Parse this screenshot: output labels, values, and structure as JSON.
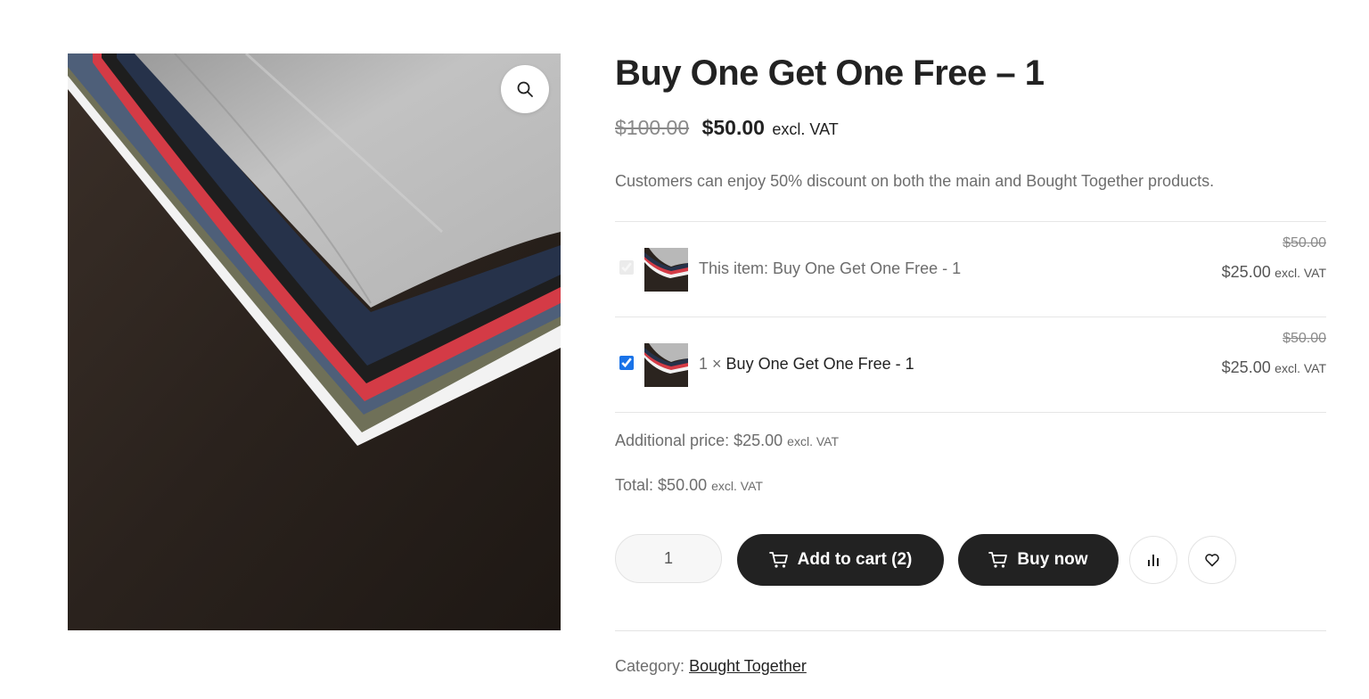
{
  "gallery": {
    "image_alt": "stack of folded t-shirts",
    "zoom_icon": "magnifier-icon"
  },
  "product": {
    "title": "Buy One Get One Free – 1",
    "price_old": "$100.00",
    "price_new": "$50.00",
    "price_suffix": "excl. VAT",
    "short_description": "Customers can enjoy 50% discount on both the main and Bought Together products."
  },
  "bought_together": {
    "items": [
      {
        "checked": true,
        "disabled": true,
        "qty_prefix": "",
        "name": "This item: Buy One Get One Free - 1",
        "price_old": "$50.00",
        "price_new": "$25.00",
        "price_suffix": "excl. VAT"
      },
      {
        "checked": true,
        "disabled": false,
        "qty_prefix": "1 ×",
        "name": "Buy One Get One Free - 1",
        "price_old": "$50.00",
        "price_new": "$25.00",
        "price_suffix": "excl. VAT"
      }
    ],
    "additional_label": "Additional price:",
    "additional_value": "$25.00",
    "additional_suffix": "excl. VAT",
    "total_label": "Total:",
    "total_value": "$50.00",
    "total_suffix": "excl. VAT"
  },
  "cart": {
    "quantity": "1",
    "add_to_cart_label": "Add to cart (2)",
    "buy_now_label": "Buy now",
    "cart_icon": "cart-icon",
    "compare_icon": "bar-chart-icon",
    "wishlist_icon": "heart-icon"
  },
  "meta": {
    "category_label": "Category:",
    "category_value": "Bought Together"
  }
}
